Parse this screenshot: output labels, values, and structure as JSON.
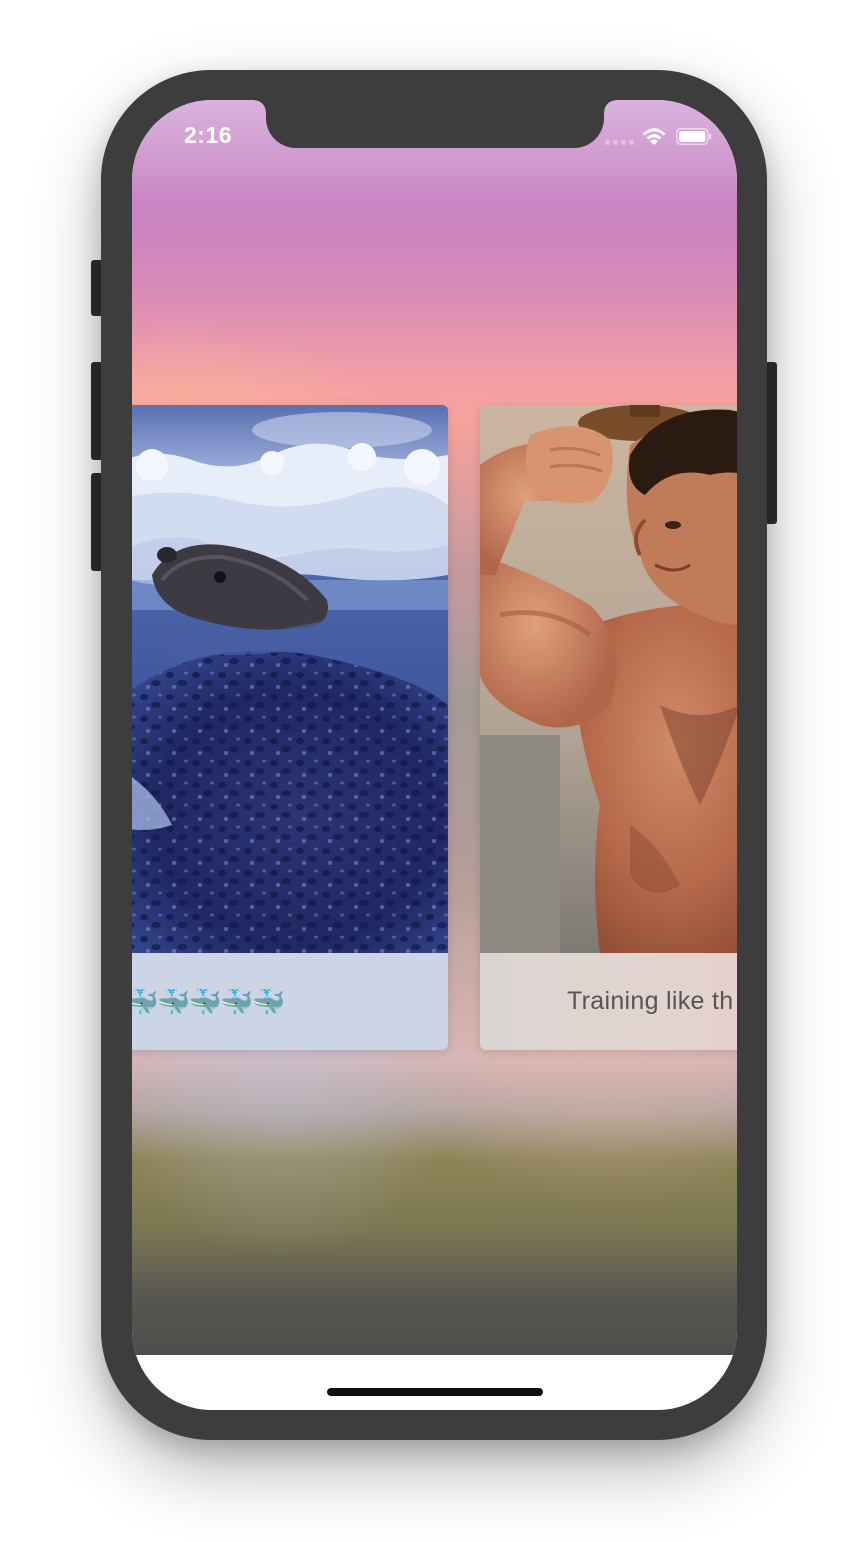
{
  "status_bar": {
    "time": "2:16",
    "wifi_icon": "wifi-icon",
    "battery_icon": "battery-icon"
  },
  "cards": [
    {
      "image": "seal-photo",
      "caption": "🐳🐳🐳🐳🐳",
      "caption_icon": "whale-emoji"
    },
    {
      "image": "flexing-man-photo",
      "caption": "Training like th"
    }
  ],
  "colors": {
    "device_frame": "#3d3d3d",
    "caption_text": "#555555"
  }
}
